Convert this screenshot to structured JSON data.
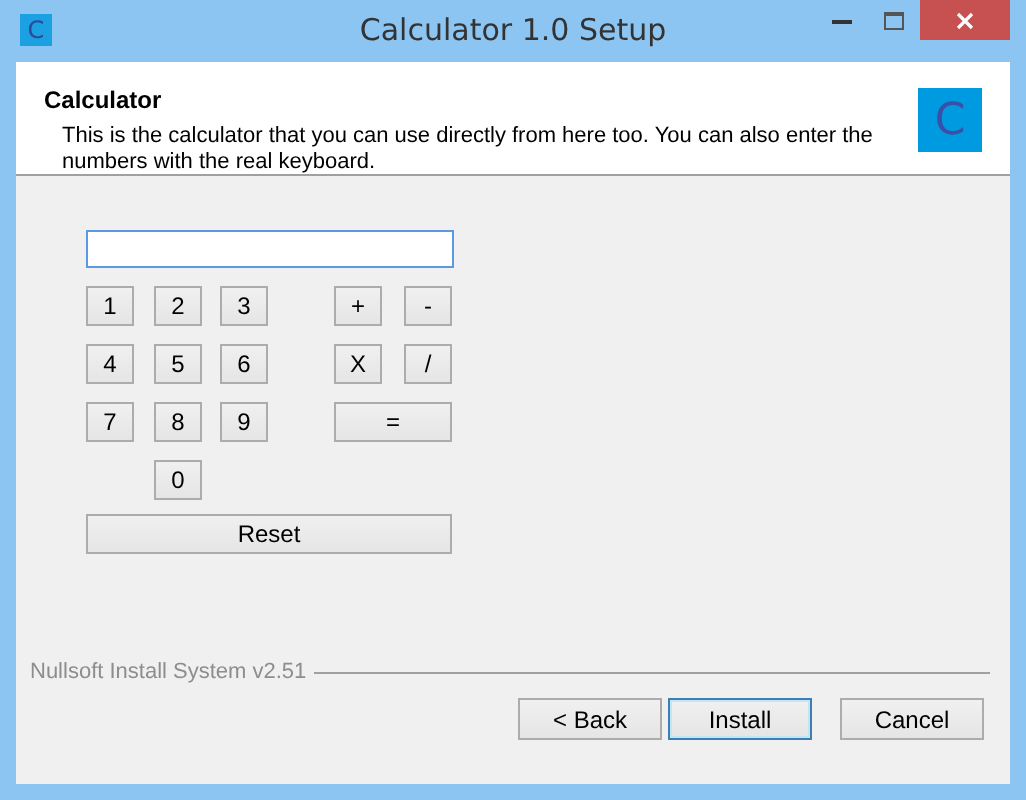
{
  "window": {
    "title": "Calculator 1.0 Setup",
    "icon_letter": "C"
  },
  "header": {
    "title": "Calculator",
    "description": "This is the calculator that you can use directly from here too. You can also enter the numbers with the real keyboard.",
    "icon_letter": "C"
  },
  "calculator": {
    "digits": [
      [
        "1",
        "2",
        "3"
      ],
      [
        "4",
        "5",
        "6"
      ],
      [
        "7",
        "8",
        "9"
      ],
      [
        "0"
      ]
    ],
    "operators": [
      [
        "+",
        "-"
      ],
      [
        "X",
        "/"
      ],
      [
        "="
      ]
    ],
    "reset": "Reset"
  },
  "branding": "Nullsoft Install System v2.51",
  "buttons": [
    {
      "label": "< Back",
      "focused": false
    },
    {
      "label": "Install",
      "focused": true
    },
    {
      "label": "Cancel",
      "focused": false
    }
  ]
}
